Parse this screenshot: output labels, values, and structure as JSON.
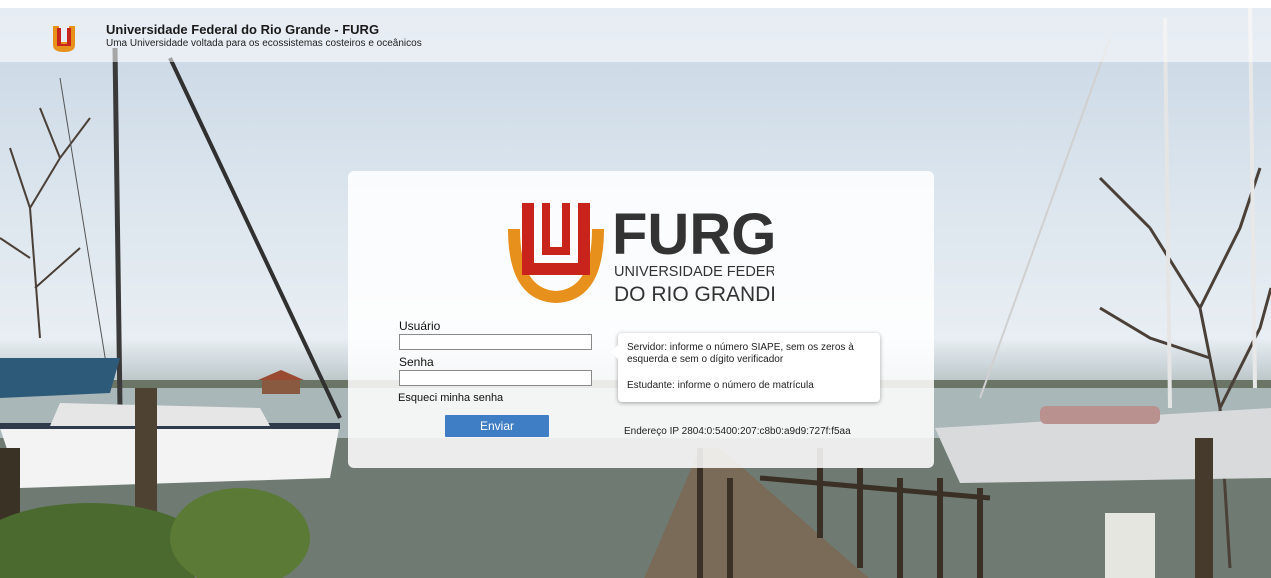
{
  "header": {
    "title": "Universidade Federal do Rio Grande - FURG",
    "subtitle": "Uma Universidade voltada para os ecossistemas costeiros e oceânicos",
    "logo_icon": "furg-shield-logo"
  },
  "login": {
    "logo": {
      "wordmark": "FURG",
      "line1": "UNIVERSIDADE FEDERAL",
      "line2": "DO RIO GRANDE"
    },
    "username": {
      "label": "Usuário",
      "value": ""
    },
    "password": {
      "label": "Senha",
      "value": ""
    },
    "forgot_label": "Esqueci minha senha",
    "submit_label": "Enviar",
    "tooltip": {
      "servidor": "Servidor: informe o número SIAPE, sem os zeros à esquerda e sem o dígito verificador",
      "estudante": "Estudante: informe o número de matrícula"
    },
    "ip_text": "Endereço IP 2804:0:5400:207:c8b0:a9d9:727f:f5aa"
  },
  "colors": {
    "brand_orange": "#e8901c",
    "brand_red": "#c8241c",
    "brand_dark": "#333333",
    "button_blue": "#3f7ec4"
  }
}
